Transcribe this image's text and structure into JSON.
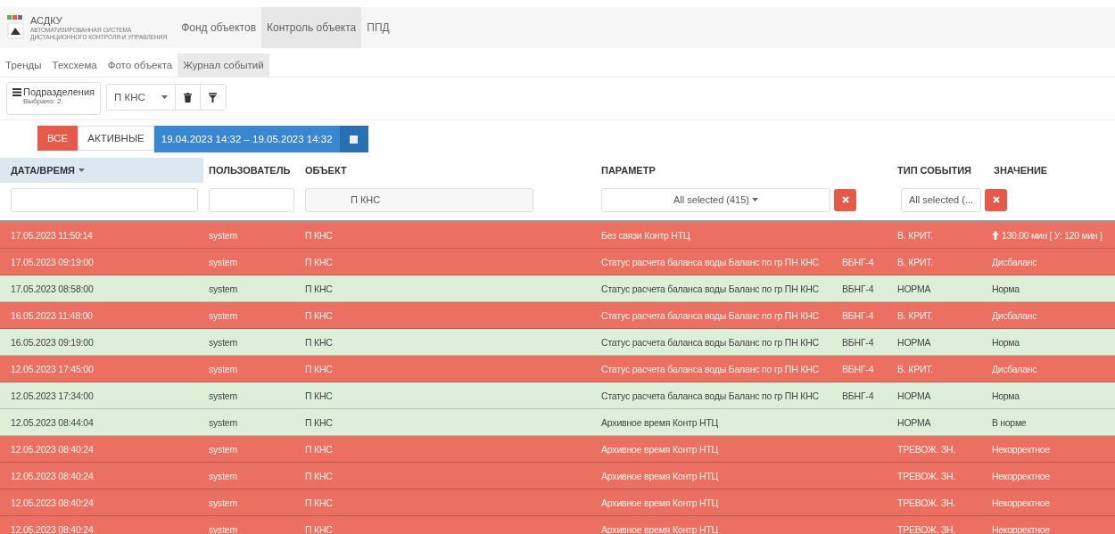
{
  "app": {
    "logo_title": "АСДКУ",
    "logo_subtitle_1": "АВТОМАТИЗИРОВАННАЯ СИСТЕМА",
    "logo_subtitle_2": "ДИСТАНЦИОННОГО КОНТРОЛЯ И УПРАВЛЕНИЯ"
  },
  "nav": [
    {
      "label": "Фонд объектов",
      "selected": false
    },
    {
      "label": "Контроль объекта",
      "selected": true
    },
    {
      "label": "ППД",
      "selected": false
    }
  ],
  "subtabs": [
    {
      "label": "Тренды",
      "selected": false
    },
    {
      "label": "Техсхема",
      "selected": false
    },
    {
      "label": "Фото объекта",
      "selected": false
    },
    {
      "label": "Журнал событий",
      "selected": true
    }
  ],
  "toolbar": {
    "subdivisions": {
      "label": "Подразделения",
      "note": "Выбрано: 2"
    },
    "object_select": "П КНС"
  },
  "toggles": [
    {
      "label": "ВСЕ",
      "selected": true
    },
    {
      "label": "АКТИВНЫЕ",
      "selected": false
    }
  ],
  "date_range": "19.04.2023 14:32 – 19.05.2023 14:32",
  "table": {
    "columns": [
      {
        "label": "ДАТА/ВРЕМЯ",
        "sorted": true
      },
      {
        "label": "ПОЛЬЗОВАТЕЛЬ",
        "sorted": false
      },
      {
        "label": "ОБЪЕКТ",
        "sorted": false
      },
      {
        "label": "ПАРАМЕТР",
        "sorted": false
      },
      {
        "label": "ТИП СОБЫТИЯ",
        "sorted": false
      },
      {
        "label": "ЗНАЧЕНИЕ",
        "sorted": false
      }
    ],
    "filters": {
      "object": "П КНС",
      "parameter": "All selected (415)",
      "event_type": "All selected (..."
    },
    "rows": [
      {
        "kind": "alarm",
        "datetime": "17.05.2023 11:50:14",
        "user": "system",
        "object": "П КНС",
        "parameter": "Без связи Контр НТЦ",
        "tag": "",
        "event_type": "В. КРИТ.",
        "value": "130.00 мин [ У: 120 мин ]",
        "rising": true
      },
      {
        "kind": "alarm",
        "datetime": "17.05.2023 09:19:00",
        "user": "system",
        "object": "П КНС",
        "parameter": "Статус расчета баланса воды Баланс по гр ПН КНС",
        "tag": "ВБНГ-4",
        "event_type": "В. КРИТ.",
        "value": "Дисбаланс",
        "rising": false
      },
      {
        "kind": "normal",
        "datetime": "17.05.2023 08:58:00",
        "user": "system",
        "object": "П КНС",
        "parameter": "Статус расчета баланса воды Баланс по гр ПН КНС",
        "tag": "ВБНГ-4",
        "event_type": "НОРМА",
        "value": "Норма",
        "rising": false
      },
      {
        "kind": "alarm",
        "datetime": "16.05.2023 11:48:00",
        "user": "system",
        "object": "П КНС",
        "parameter": "Статус расчета баланса воды Баланс по гр ПН КНС",
        "tag": "ВБНГ-4",
        "event_type": "В. КРИТ.",
        "value": "Дисбаланс",
        "rising": false
      },
      {
        "kind": "normal",
        "datetime": "16.05.2023 09:19:00",
        "user": "system",
        "object": "П КНС",
        "parameter": "Статус расчета баланса воды Баланс по гр ПН КНС",
        "tag": "ВБНГ-4",
        "event_type": "НОРМА",
        "value": "Норма",
        "rising": false
      },
      {
        "kind": "alarm",
        "datetime": "12.05.2023 17:45:00",
        "user": "system",
        "object": "П КНС",
        "parameter": "Статус расчета баланса воды Баланс по гр ПН КНС",
        "tag": "ВБНГ-4",
        "event_type": "В. КРИТ.",
        "value": "Дисбаланс",
        "rising": false
      },
      {
        "kind": "normal",
        "datetime": "12.05.2023 17:34:00",
        "user": "system",
        "object": "П КНС",
        "parameter": "Статус расчета баланса воды Баланс по гр ПН КНС",
        "tag": "ВБНГ-4",
        "event_type": "НОРМА",
        "value": "Норма",
        "rising": false
      },
      {
        "kind": "normal",
        "datetime": "12.05.2023 08:44:04",
        "user": "system",
        "object": "П КНС",
        "parameter": "Архивное время Контр НТЦ",
        "tag": "",
        "event_type": "НОРМА",
        "value": "В норме",
        "rising": false
      },
      {
        "kind": "alarm",
        "datetime": "12.05.2023 08:40:24",
        "user": "system",
        "object": "П КНС",
        "parameter": "Архивное время Контр НТЦ",
        "tag": "",
        "event_type": "ТРЕВОЖ. ЗН.",
        "value": "Некорректное",
        "rising": false
      },
      {
        "kind": "alarm",
        "datetime": "12.05.2023 08:40:24",
        "user": "system",
        "object": "П КНС",
        "parameter": "Архивное время Контр НТЦ",
        "tag": "",
        "event_type": "ТРЕВОЖ. ЗН.",
        "value": "Некорректное",
        "rising": false
      },
      {
        "kind": "alarm",
        "datetime": "12.05.2023 08:40:24",
        "user": "system",
        "object": "П КНС",
        "parameter": "Архивное время Контр НТЦ",
        "tag": "",
        "event_type": "ТРЕВОЖ. ЗН.",
        "value": "Некорректное",
        "rising": false
      },
      {
        "kind": "alarm",
        "datetime": "12.05.2023 08:40:24",
        "user": "system",
        "object": "П КНС",
        "parameter": "Архивное время Контр НТЦ",
        "tag": "",
        "event_type": "ТРЕВОЖ. ЗН.",
        "value": "Некорректное",
        "rising": false
      }
    ]
  }
}
